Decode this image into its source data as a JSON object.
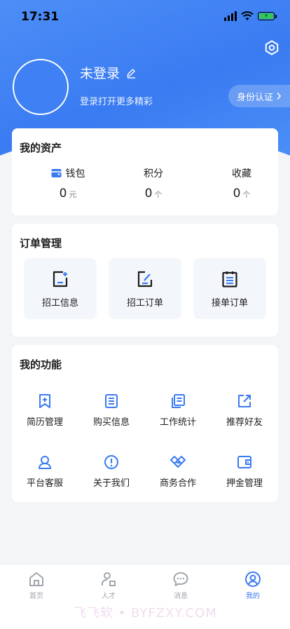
{
  "status_bar": {
    "time": "17:31"
  },
  "profile": {
    "title": "未登录",
    "subtitle": "登录打开更多精彩",
    "id_verify_label": "身份认证"
  },
  "assets": {
    "title": "我的资产",
    "items": [
      {
        "label": "钱包",
        "value": "0",
        "unit": "元",
        "icon": "wallet-icon"
      },
      {
        "label": "积分",
        "value": "0",
        "unit": "个"
      },
      {
        "label": "收藏",
        "value": "0",
        "unit": "个"
      }
    ]
  },
  "orders": {
    "title": "订单管理",
    "items": [
      {
        "label": "招工信息",
        "icon": "add-document-icon"
      },
      {
        "label": "招工订单",
        "icon": "edit-document-icon"
      },
      {
        "label": "接单订单",
        "icon": "clipboard-icon"
      }
    ]
  },
  "functions": {
    "title": "我的功能",
    "items": [
      {
        "label": "简历管理",
        "icon": "bookmark-plus-icon"
      },
      {
        "label": "购买信息",
        "icon": "list-document-icon"
      },
      {
        "label": "工作统计",
        "icon": "stacked-documents-icon"
      },
      {
        "label": "推荐好友",
        "icon": "share-icon"
      },
      {
        "label": "平台客服",
        "icon": "customer-service-icon"
      },
      {
        "label": "关于我们",
        "icon": "info-icon"
      },
      {
        "label": "商务合作",
        "icon": "handshake-icon"
      },
      {
        "label": "押金管理",
        "icon": "wallet-icon"
      }
    ]
  },
  "tabbar": {
    "items": [
      {
        "label": "首页",
        "icon": "home-icon"
      },
      {
        "label": "人才",
        "icon": "person-icon"
      },
      {
        "label": "消息",
        "icon": "message-icon"
      },
      {
        "label": "我的",
        "icon": "user-circle-icon",
        "active": true
      }
    ]
  },
  "watermark": "飞飞软 • BYFZXY.COM",
  "colors": {
    "primary": "#3a7bf2",
    "background": "#f4f5f7",
    "tab_inactive": "#a1a6ad"
  }
}
